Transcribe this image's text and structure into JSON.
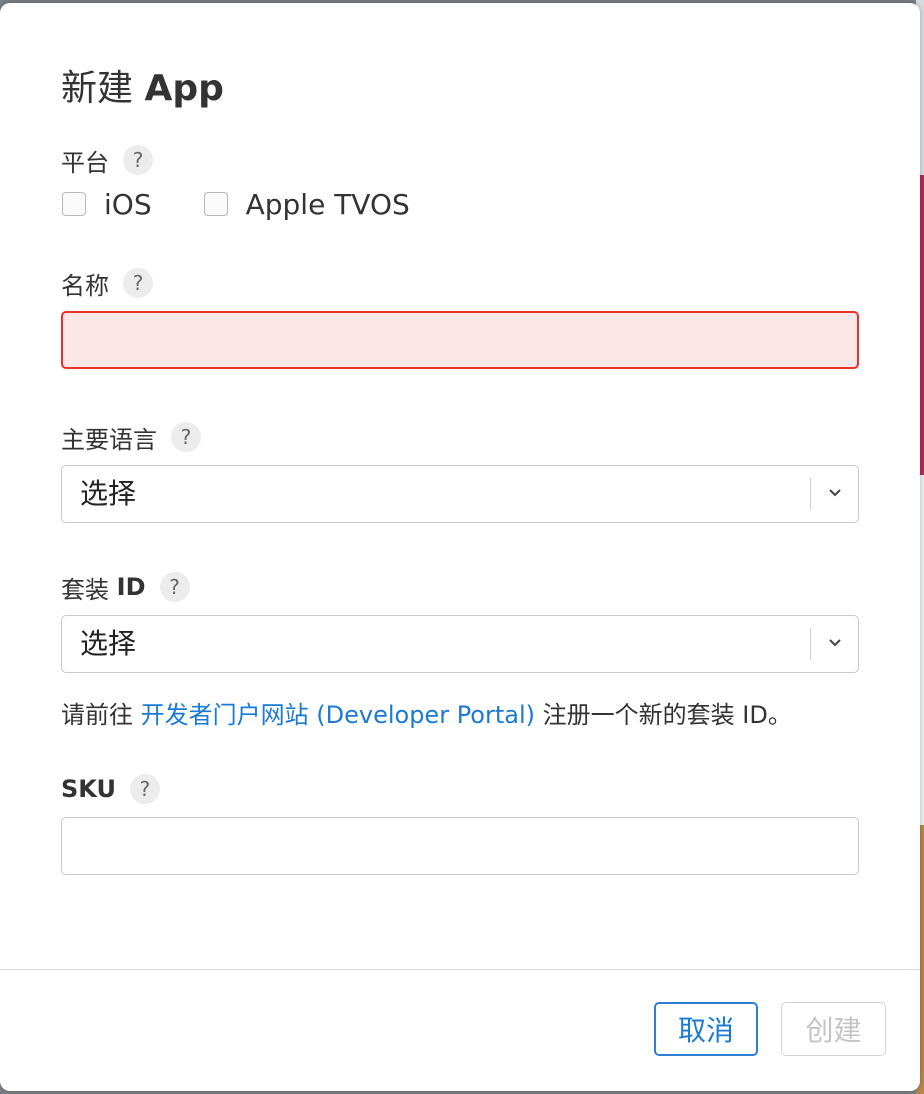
{
  "dialog": {
    "title_prefix": "新建",
    "title_app": "App"
  },
  "platform": {
    "label": "平台",
    "help": "?",
    "options": [
      {
        "label": "iOS",
        "checked": false
      },
      {
        "label": "Apple TVOS",
        "checked": false
      }
    ]
  },
  "name": {
    "label": "名称",
    "help": "?",
    "value": "",
    "state": "error"
  },
  "primary_language": {
    "label": "主要语言",
    "help": "?",
    "selected": "选择"
  },
  "bundle_id": {
    "label_prefix": "套装",
    "label_bold": "ID",
    "help": "?",
    "selected": "选择",
    "note_before": "请前往 ",
    "note_link": "开发者门户网站 (Developer Portal)",
    "note_after": " 注册一个新的套装 ID。"
  },
  "sku": {
    "label": "SKU",
    "help": "?",
    "value": ""
  },
  "buttons": {
    "cancel": "取消",
    "create": "创建"
  },
  "colors": {
    "link": "#1a7ad4",
    "error_border": "#e8312f",
    "error_bg": "#fde6e6"
  }
}
